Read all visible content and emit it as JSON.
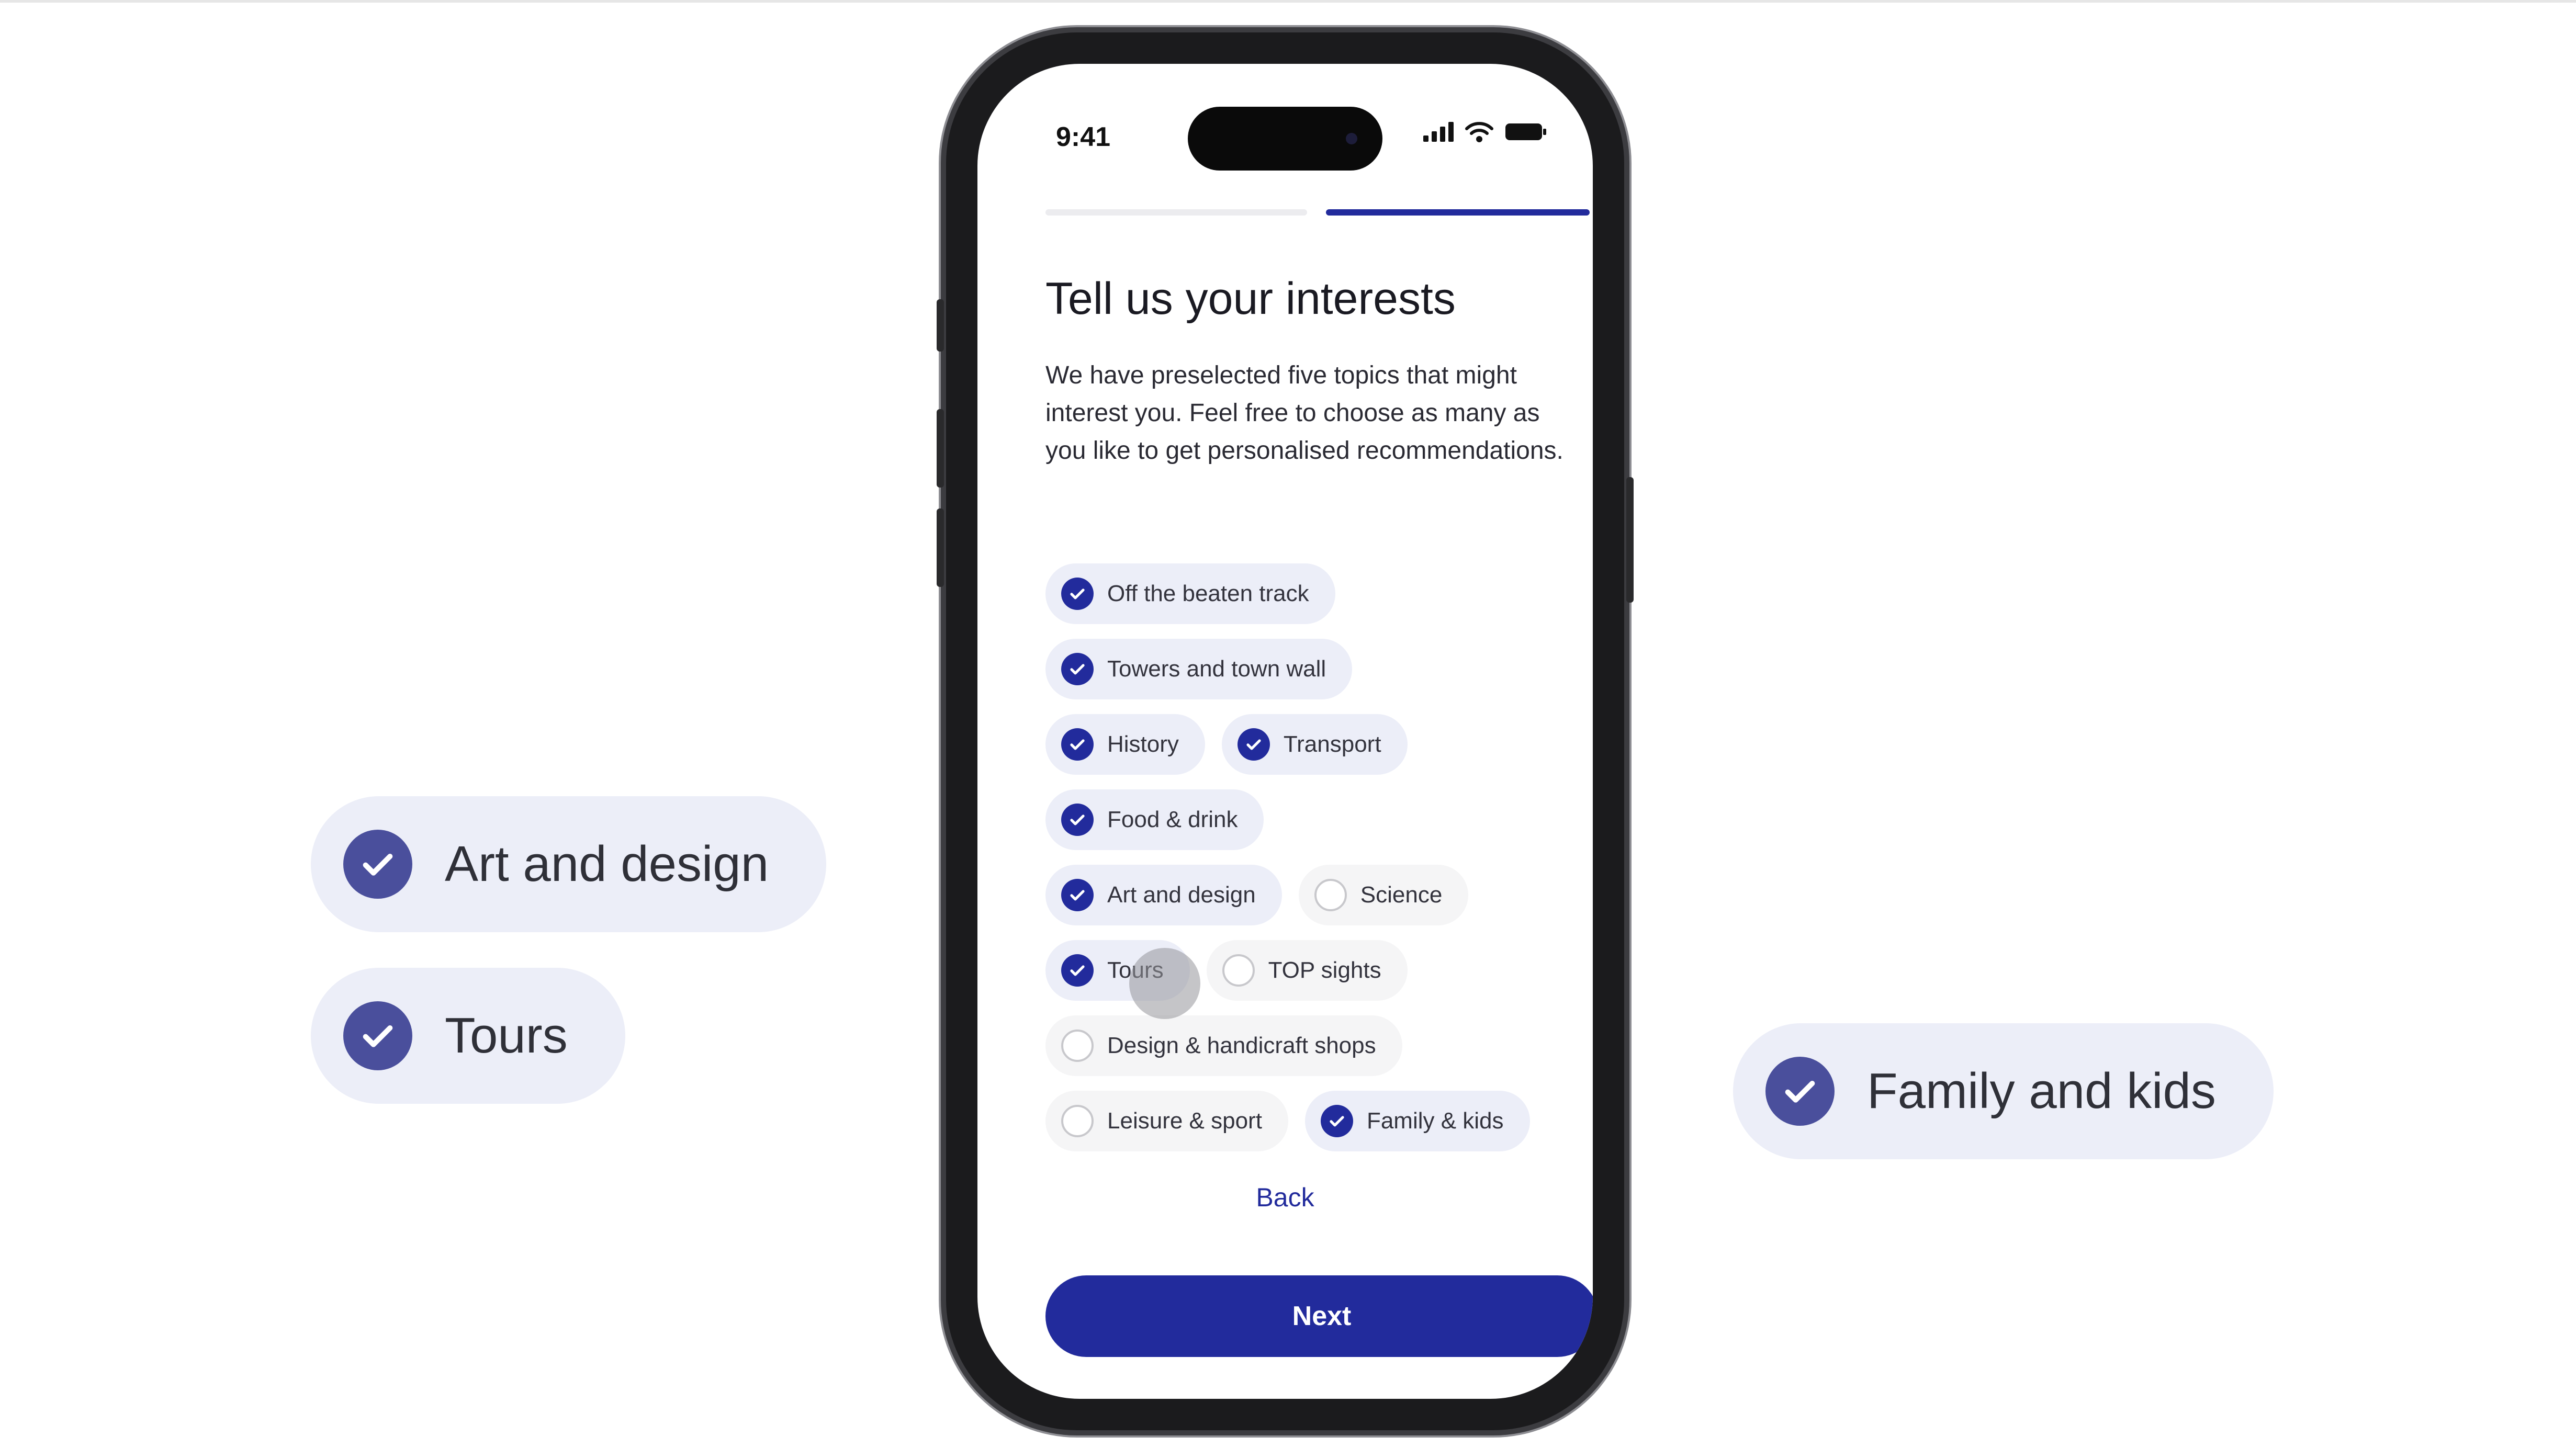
{
  "callouts": {
    "left_top": {
      "label": "Art and design",
      "checked": true
    },
    "left_bottom": {
      "label": "Tours",
      "checked": true
    },
    "right": {
      "label": "Family and kids",
      "checked": true
    }
  },
  "phone": {
    "status_bar": {
      "time": "9:41",
      "icons": [
        "signal-icon",
        "wifi-icon",
        "battery-icon"
      ]
    },
    "progress": {
      "current_step": 2,
      "total_steps": 2
    },
    "title": "Tell us your interests",
    "description": "We have preselected five topics that might interest you. Feel free to choose as many as you like to get personalised recommendations.",
    "chip_rows": [
      [
        {
          "label": "Off the beaten track",
          "checked": true
        }
      ],
      [
        {
          "label": "Towers and town wall",
          "checked": true
        }
      ],
      [
        {
          "label": "History",
          "checked": true
        },
        {
          "label": "Transport",
          "checked": true
        }
      ],
      [
        {
          "label": "Food & drink",
          "checked": true
        }
      ],
      [
        {
          "label": "Art and design",
          "checked": true
        },
        {
          "label": "Science",
          "checked": false
        }
      ],
      [
        {
          "label": "Tours",
          "checked": true
        },
        {
          "label": "TOP sights",
          "checked": false
        }
      ],
      [
        {
          "label": "Design & handicraft shops",
          "checked": false
        }
      ],
      [
        {
          "label": "Leisure & sport",
          "checked": false
        },
        {
          "label": "Family & kids",
          "checked": true
        }
      ]
    ],
    "back_label": "Back",
    "next_label": "Next"
  },
  "colors": {
    "accent": "#222b9c",
    "callout_check": "#4a4f9c",
    "chip_selected_bg": "#eceef8",
    "progress_inactive": "#ececef"
  }
}
